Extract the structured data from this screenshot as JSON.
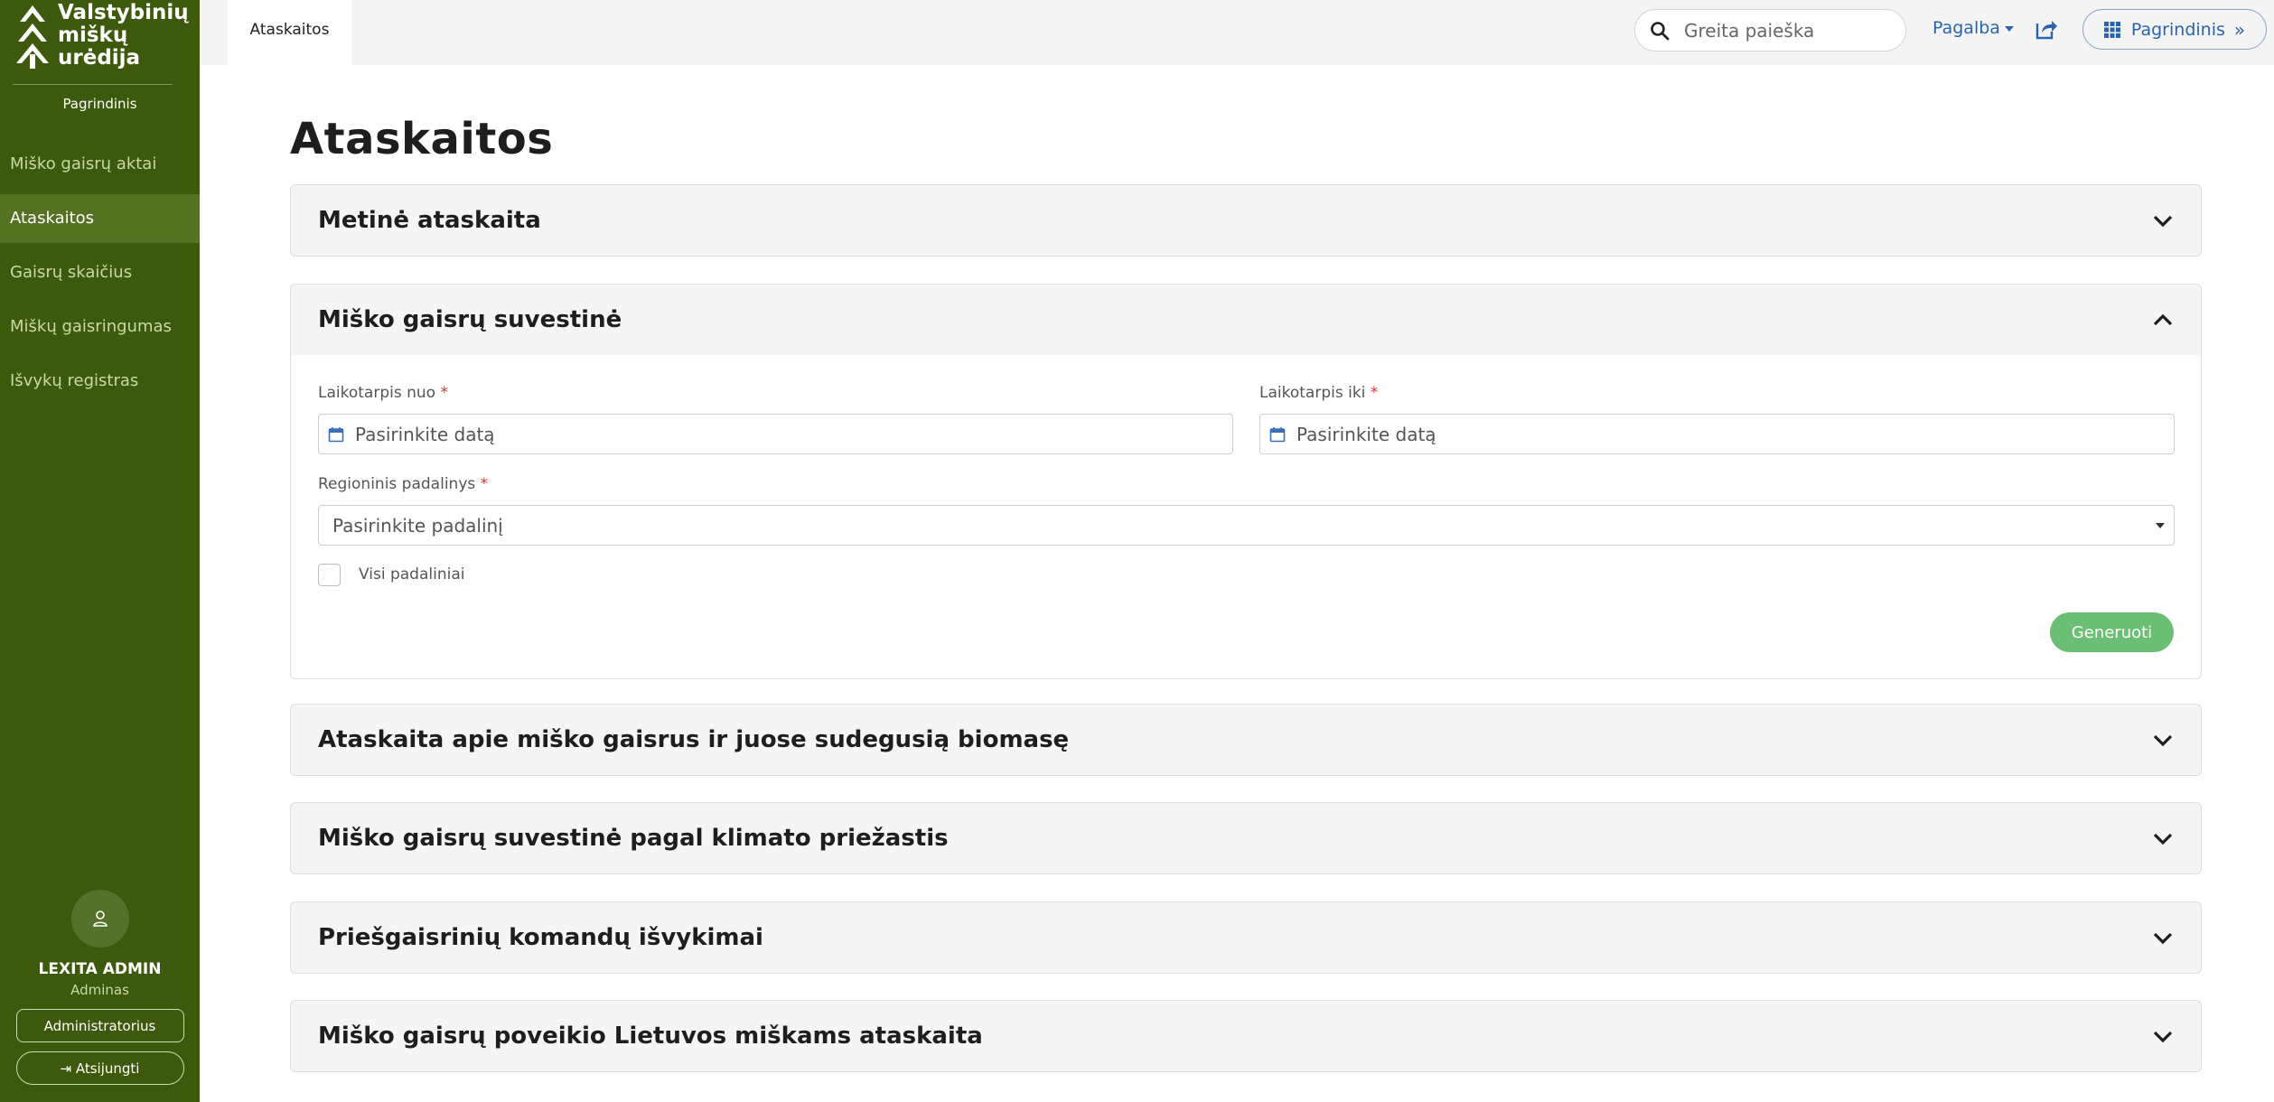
{
  "logo": {
    "lines": [
      "Valstybinių",
      "miškų",
      "urėdija"
    ]
  },
  "sidebar": {
    "home_label": "Pagrindinis",
    "items": [
      {
        "label": "Miško gaisrų aktai",
        "active": false
      },
      {
        "label": "Ataskaitos",
        "active": true
      },
      {
        "label": "Gaisrų skaičius",
        "active": false
      },
      {
        "label": "Miškų gaisringumas",
        "active": false
      },
      {
        "label": "Išvykų registras",
        "active": false
      }
    ],
    "user": {
      "name": "LEXITA ADMIN",
      "role": "Adminas",
      "admin_button": "Administratorius",
      "logout_button": "Atsijungti"
    }
  },
  "topbar": {
    "active_tab": "Ataskaitos",
    "search_placeholder": "Greita paieška",
    "help_label": "Pagalba",
    "main_button": "Pagrindinis"
  },
  "page": {
    "title": "Ataskaitos",
    "accordions": [
      {
        "title": "Metinė ataskaita",
        "open": false
      },
      {
        "title": "Miško gaisrų suvestinė",
        "open": true,
        "form": {
          "from_label": "Laikotarpis nuo",
          "from_placeholder": "Pasirinkite datą",
          "to_label": "Laikotarpis iki",
          "to_placeholder": "Pasirinkite datą",
          "region_label": "Regioninis padalinys",
          "region_placeholder": "Pasirinkite padalinį",
          "all_units_label": "Visi padaliniai",
          "all_units_checked": false,
          "required_mark": "*",
          "generate_button": "Generuoti"
        }
      },
      {
        "title": "Ataskaita apie miško gaisrus ir juose sudegusią biomasę",
        "open": false
      },
      {
        "title": "Miško gaisrų suvestinė pagal klimato priežastis",
        "open": false
      },
      {
        "title": "Priešgaisrinių komandų išvykimai",
        "open": false
      },
      {
        "title": "Miško gaisrų poveikio Lietuvos miškams ataskaita",
        "open": false
      }
    ]
  },
  "colors": {
    "sidebar_bg": "#3d5a0c",
    "sidebar_active_bg": "#557222",
    "link_blue": "#2a64b0",
    "generate_green": "#6abf74",
    "required_red": "#d9342b"
  }
}
